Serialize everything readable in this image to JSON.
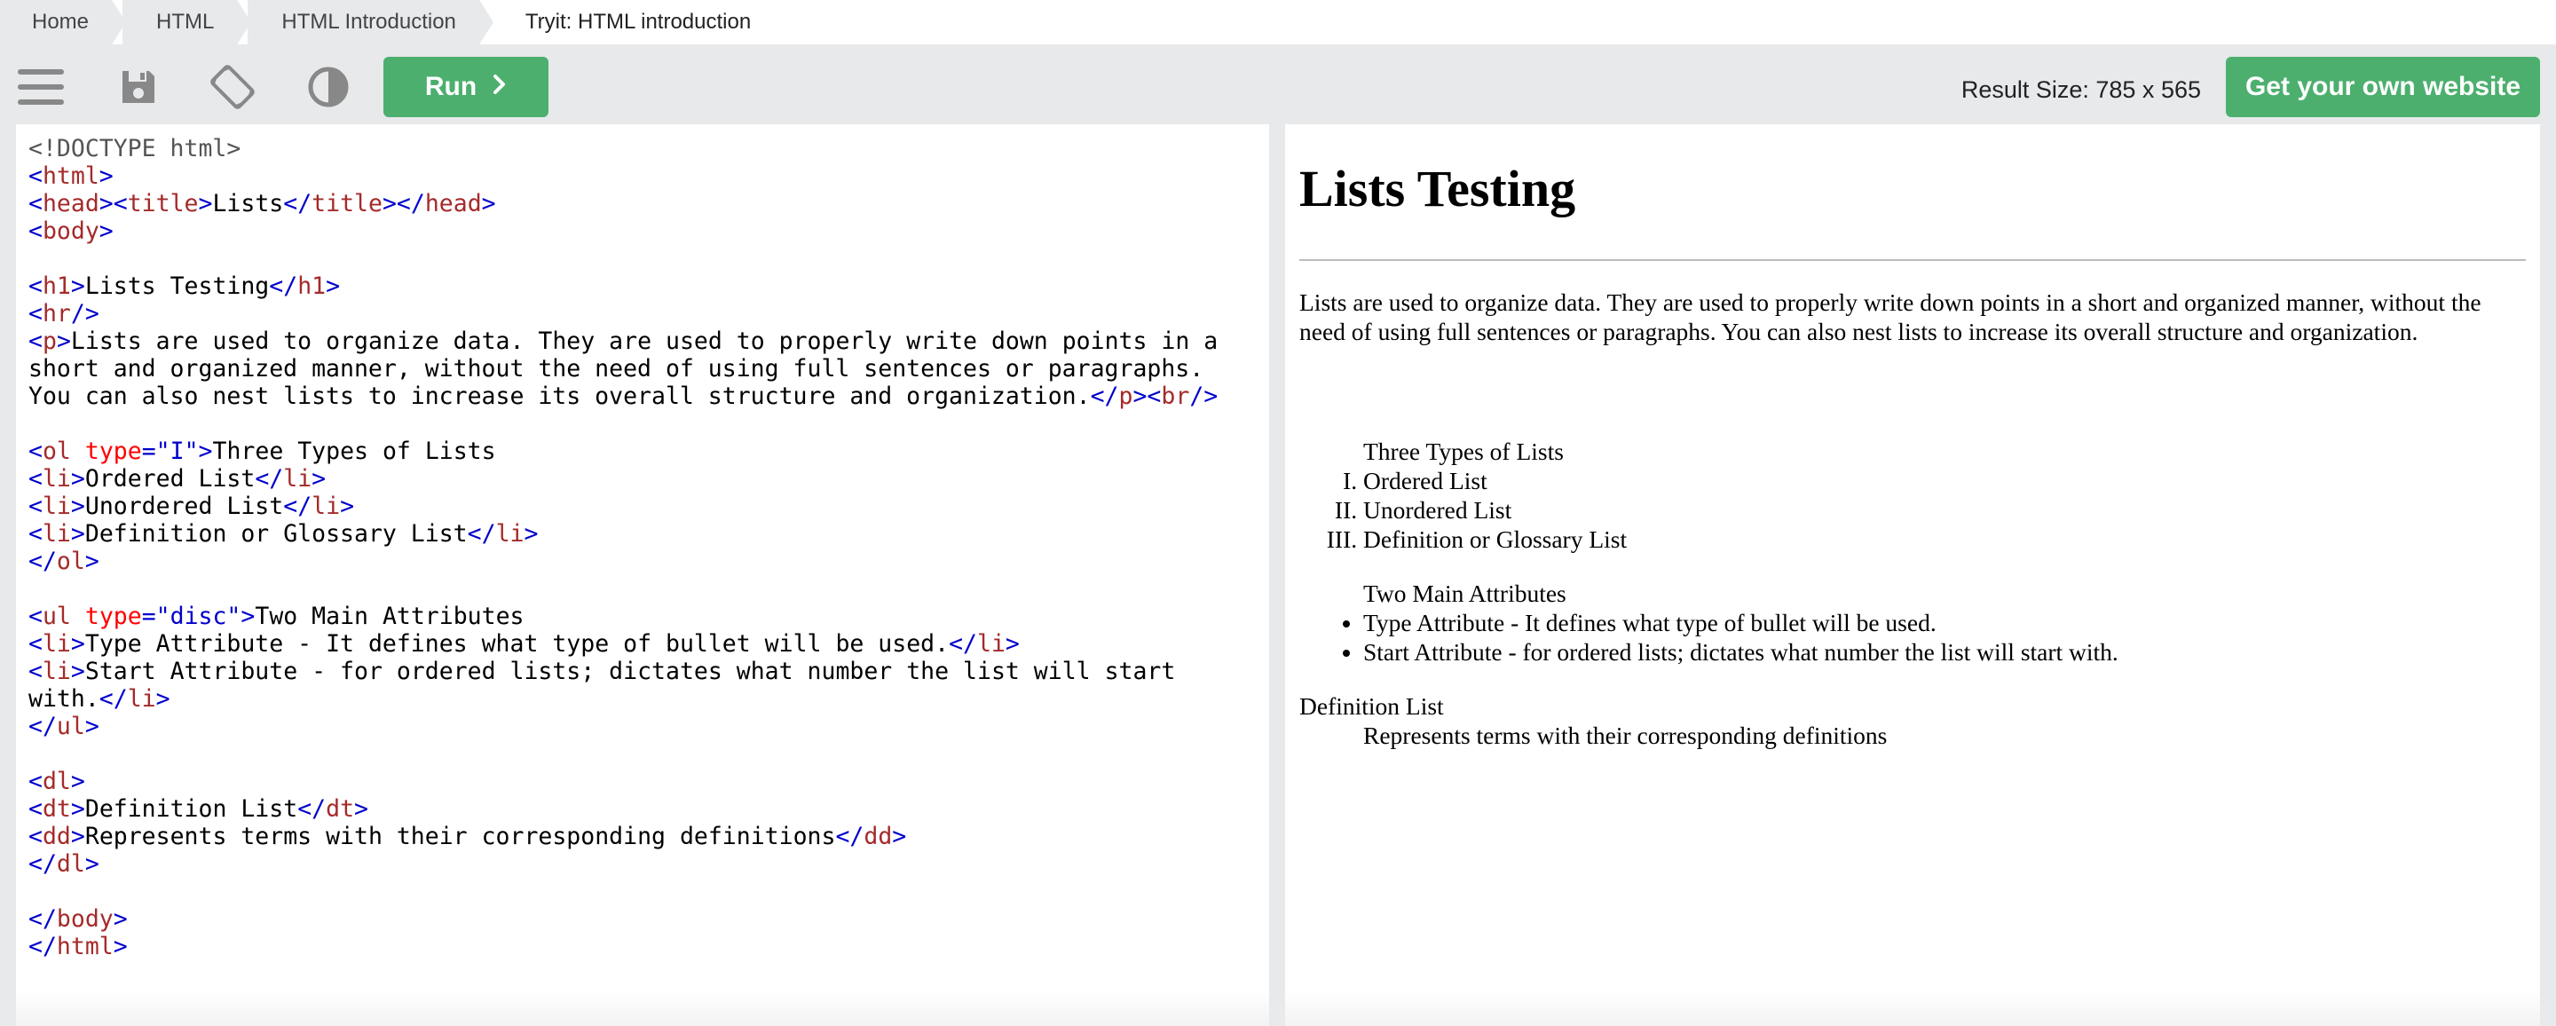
{
  "breadcrumb": {
    "items": [
      "Home",
      "HTML",
      "HTML Introduction"
    ],
    "current": "Tryit: HTML introduction"
  },
  "toolbar": {
    "icons": [
      "menu-icon",
      "save-icon",
      "rotate-icon",
      "contrast-icon"
    ],
    "run_label": "Run",
    "result_size_label": "Result Size: 785 x 565",
    "get_site_label": "Get your own website",
    "accent_color": "#4caf6e"
  },
  "code": {
    "doctype": "<!DOCTYPE html>",
    "h1_text": "Lists Testing",
    "title_text": "Lists",
    "p_line1": "Lists are used to organize data. They are used to properly write down points in a",
    "p_line2": "short and organized manner, without the need of using full sentences or paragraphs.",
    "p_line3": "You can also nest lists to increase its overall structure and organization.",
    "ol_type": "\"I\"",
    "ol_text": "Three Types of Lists",
    "ol_items": [
      "Ordered List",
      "Unordered List",
      "Definition or Glossary List"
    ],
    "ul_type": "\"disc\"",
    "ul_text": "Two Main Attributes",
    "ul_item1": "Type Attribute - It defines what type of bullet will be used.",
    "ul_item2_line1": "Start Attribute - for ordered lists; dictates what number the list will start",
    "ul_item2_line2": "with.",
    "dt_text": "Definition List",
    "dd_text": "Represents terms with their corresponding definitions"
  },
  "result": {
    "h1": "Lists Testing",
    "paragraph": "Lists are used to organize data. They are used to properly write down points in a short and organized manner, without the need of using full sentences or paragraphs. You can also nest lists to increase its overall structure and organization.",
    "ol_heading": "Three Types of Lists",
    "ol_items": [
      "Ordered List",
      "Unordered List",
      "Definition or Glossary List"
    ],
    "ul_heading": "Two Main Attributes",
    "ul_items": [
      "Type Attribute - It defines what type of bullet will be used.",
      "Start Attribute - for ordered lists; dictates what number the list will start with."
    ],
    "dt": "Definition List",
    "dd": "Represents terms with their corresponding definitions"
  }
}
